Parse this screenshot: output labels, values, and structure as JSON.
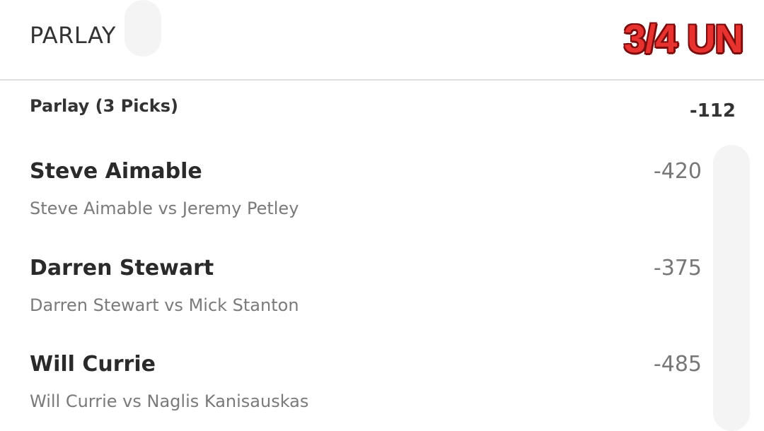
{
  "header": {
    "title": "PARLAY",
    "stamp": "3/4 UN"
  },
  "summary": {
    "label": "Parlay (3 Picks)",
    "odds": "-112"
  },
  "picks": [
    {
      "name": "Steve Aimable",
      "odds": "-420",
      "match": "Steve Aimable vs Jeremy Petley"
    },
    {
      "name": "Darren Stewart",
      "odds": "-375",
      "match": "Darren Stewart vs Mick Stanton"
    },
    {
      "name": "Will Currie",
      "odds": "-485",
      "match": "Will Currie vs Naglis Kanisauskas"
    }
  ],
  "colors": {
    "stamp": "#e8322f",
    "divider": "#dedede"
  }
}
